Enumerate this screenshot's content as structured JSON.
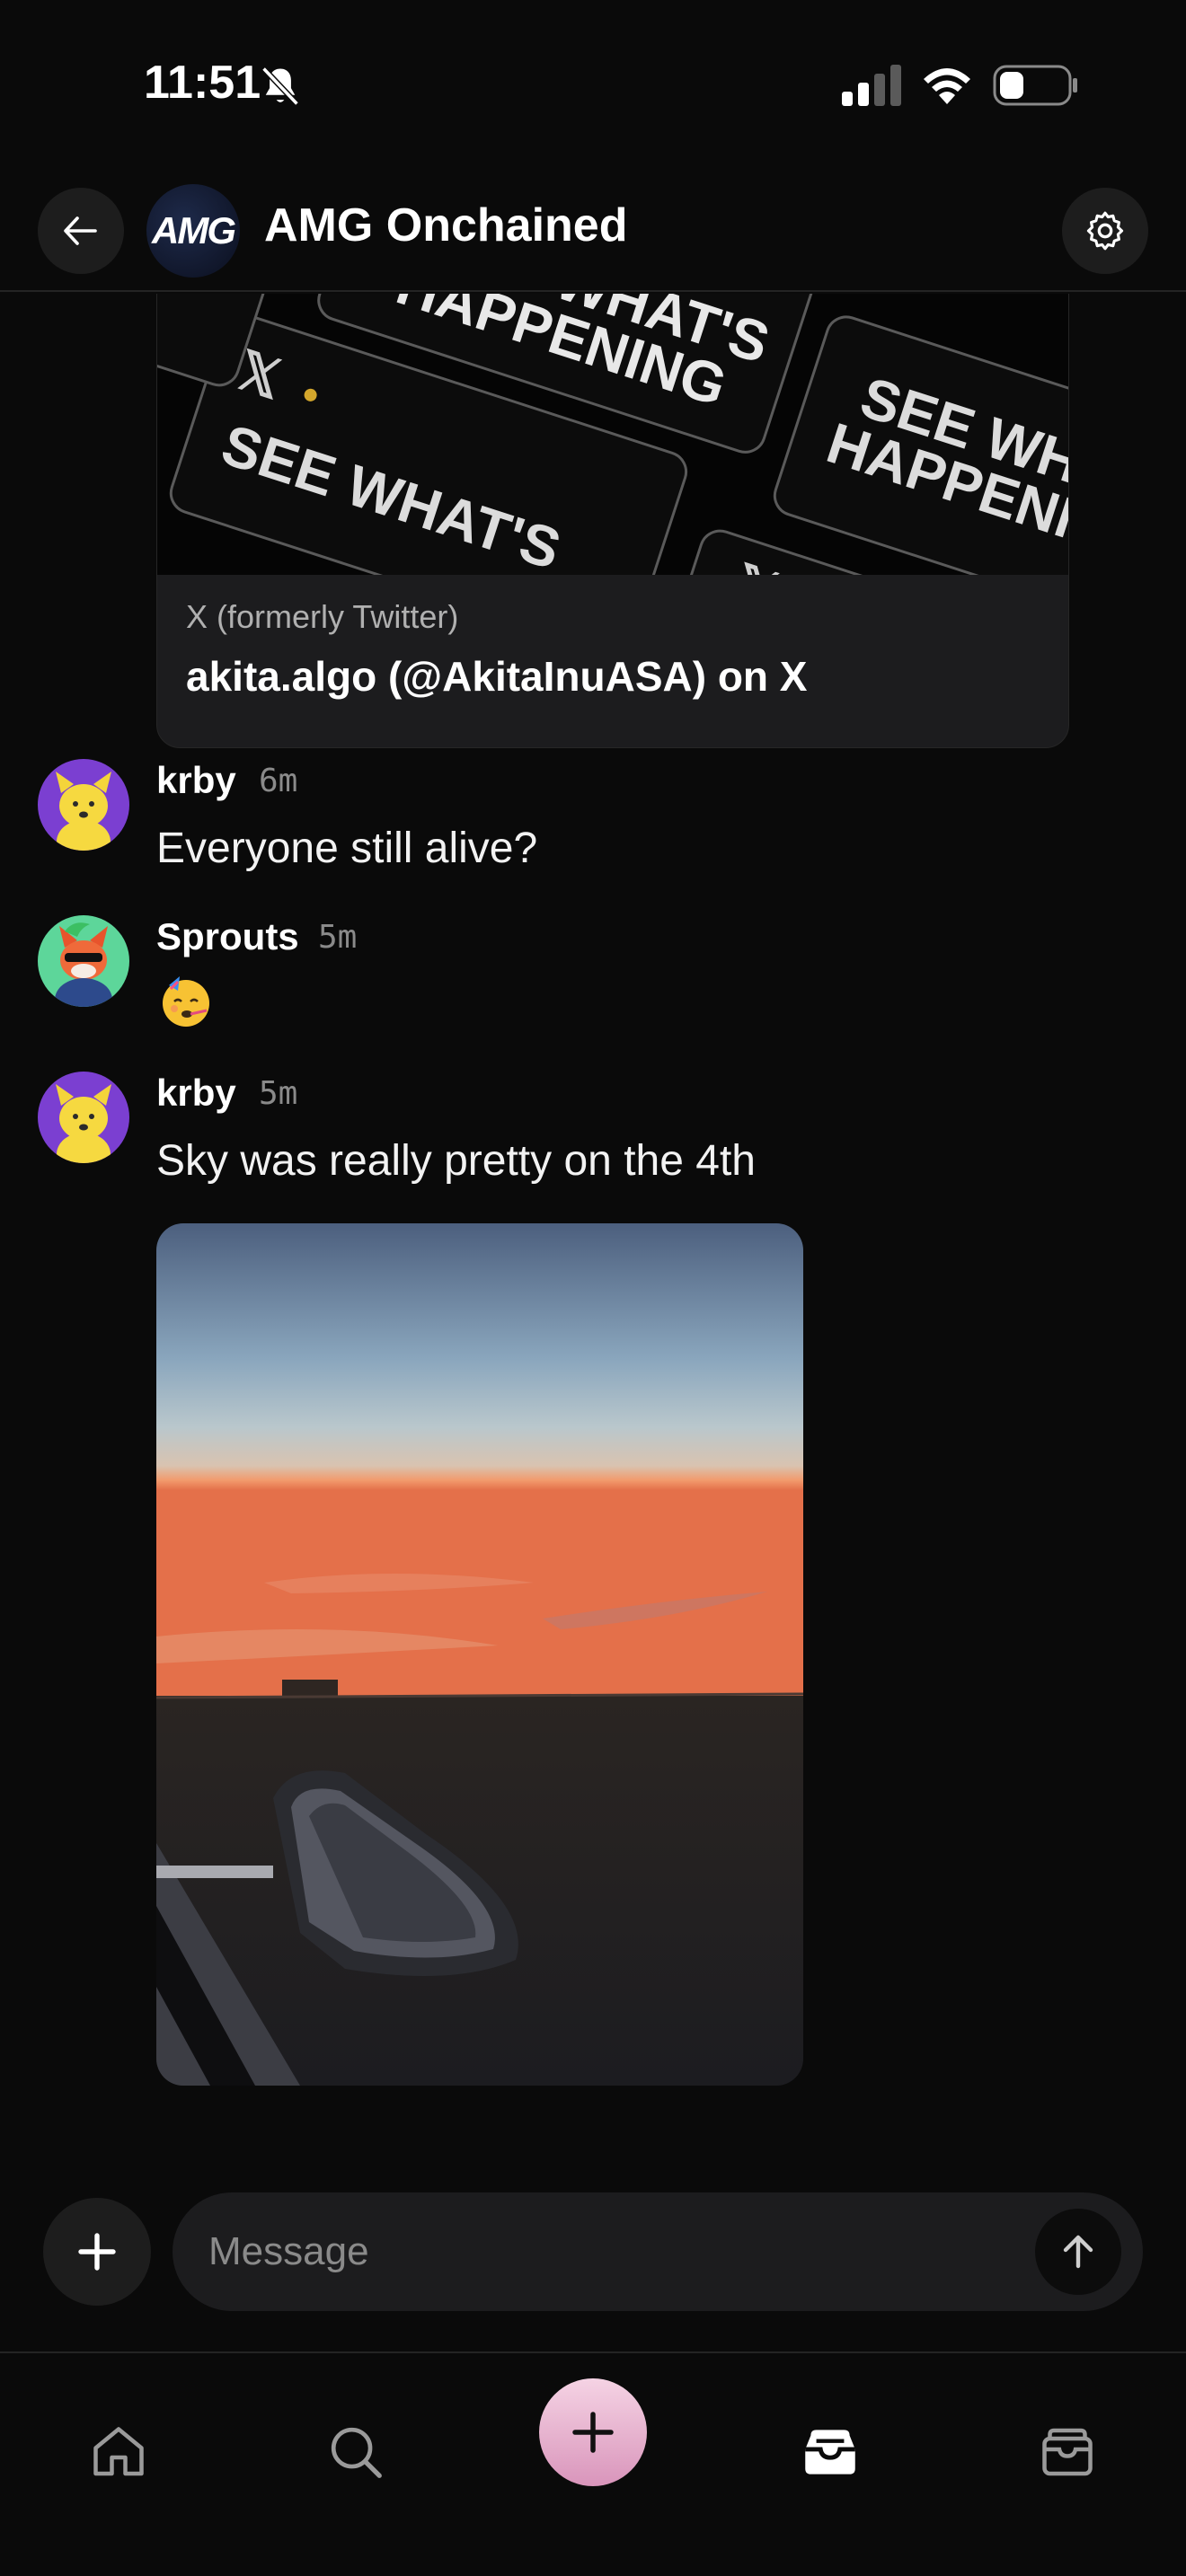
{
  "status_bar": {
    "time": "11:51",
    "icons": [
      "bell-muted-icon",
      "cellular-signal-icon",
      "wifi-icon",
      "battery-icon"
    ]
  },
  "header": {
    "title": "AMG Onchained",
    "logo_text": "AMG",
    "back_icon": "arrow-left-icon",
    "settings_icon": "gear-icon"
  },
  "link_preview": {
    "source": "X (formerly Twitter)",
    "title": "akita.algo (@AkitaInuASA) on X",
    "image_text": [
      "SEE WHAT'S",
      "HAPPENING"
    ]
  },
  "messages": [
    {
      "author": "krby",
      "time": "6m",
      "text": "Everyone still alive?",
      "avatar": "yellow-dog-avatar"
    },
    {
      "author": "Sprouts",
      "time": "5m",
      "text": "",
      "emoji": "party-face-emoji",
      "avatar": "fox-sunglasses-avatar"
    },
    {
      "author": "krby",
      "time": "5m",
      "text": "Sky was really pretty on the 4th",
      "avatar": "yellow-dog-avatar",
      "attachment": "sunset-car-mirror-photo"
    }
  ],
  "composer": {
    "placeholder": "Message",
    "add_icon": "plus-icon",
    "send_icon": "arrow-up-icon"
  },
  "bottom_nav": {
    "items": [
      "home-icon",
      "search-icon",
      "create-plus-icon",
      "inbox-icon",
      "wallet-icon"
    ],
    "active": "inbox-icon"
  },
  "colors": {
    "background": "#0a0a0a",
    "surface": "#1c1c1e",
    "accent_pink": "#e4a8c9"
  }
}
